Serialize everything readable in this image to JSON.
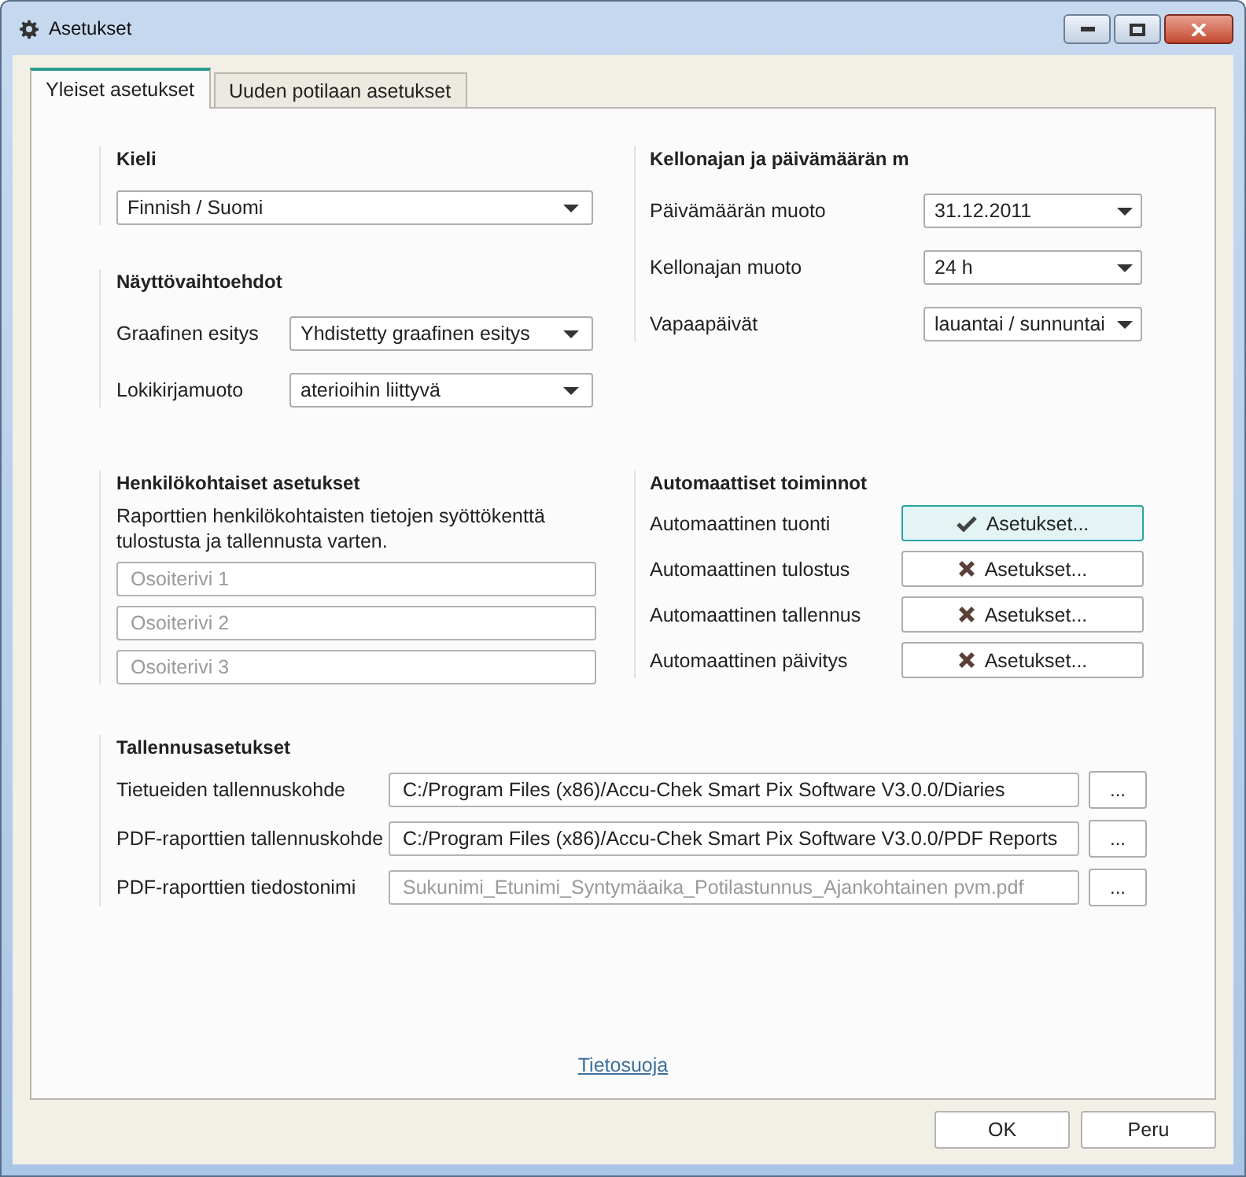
{
  "window": {
    "title": "Asetukset"
  },
  "tabs": [
    {
      "label": "Yleiset asetukset",
      "selected": true
    },
    {
      "label": "Uuden potilaan asetukset",
      "selected": false
    }
  ],
  "language": {
    "heading": "Kieli",
    "value": "Finnish / Suomi"
  },
  "display": {
    "heading": "Näyttövaihtoehdot",
    "rows": [
      {
        "label": "Graafinen esitys",
        "value": "Yhdistetty graafinen esitys"
      },
      {
        "label": "Lokikirjamuoto",
        "value": "aterioihin liittyvä"
      }
    ]
  },
  "datetime": {
    "heading": "Kellonajan ja päivämäärän m",
    "rows": [
      {
        "label": "Päivämäärän muoto",
        "value": "31.12.2011"
      },
      {
        "label": "Kellonajan muoto",
        "value": "24 h"
      },
      {
        "label": "Vapaapäivät",
        "value": "lauantai / sunnuntai"
      }
    ]
  },
  "personal": {
    "heading": "Henkilökohtaiset asetukset",
    "description": "Raporttien henkilökohtaisten tietojen syöttökenttä tulostusta ja tallennusta varten.",
    "fields": [
      {
        "placeholder": "Osoiterivi 1"
      },
      {
        "placeholder": "Osoiterivi 2"
      },
      {
        "placeholder": "Osoiterivi 3"
      }
    ]
  },
  "automatic": {
    "heading": "Automaattiset toiminnot",
    "rows": [
      {
        "label": "Automaattinen tuonti",
        "button": "Asetukset...",
        "on": true
      },
      {
        "label": "Automaattinen tulostus",
        "button": "Asetukset...",
        "on": false
      },
      {
        "label": "Automaattinen tallennus",
        "button": "Asetukset...",
        "on": false
      },
      {
        "label": "Automaattinen päivitys",
        "button": "Asetukset...",
        "on": false
      }
    ]
  },
  "storage": {
    "heading": "Tallennusasetukset",
    "rows": [
      {
        "label": "Tietueiden tallennuskohde",
        "value": "C:/Program Files (x86)/Accu-Chek Smart Pix Software V3.0.0/Diaries",
        "browse": "..."
      },
      {
        "label": "PDF-raporttien tallennuskohde",
        "value": "C:/Program Files (x86)/Accu-Chek Smart Pix Software V3.0.0/PDF Reports",
        "browse": "..."
      },
      {
        "label": "PDF-raporttien tiedostonimi",
        "placeholder": "Sukunimi_Etunimi_Syntymäaika_Potilastunnus_Ajankohtainen pvm.pdf",
        "browse": "..."
      }
    ]
  },
  "privacy_link": "Tietosuoja",
  "buttons": [
    "OK",
    "Peru"
  ]
}
